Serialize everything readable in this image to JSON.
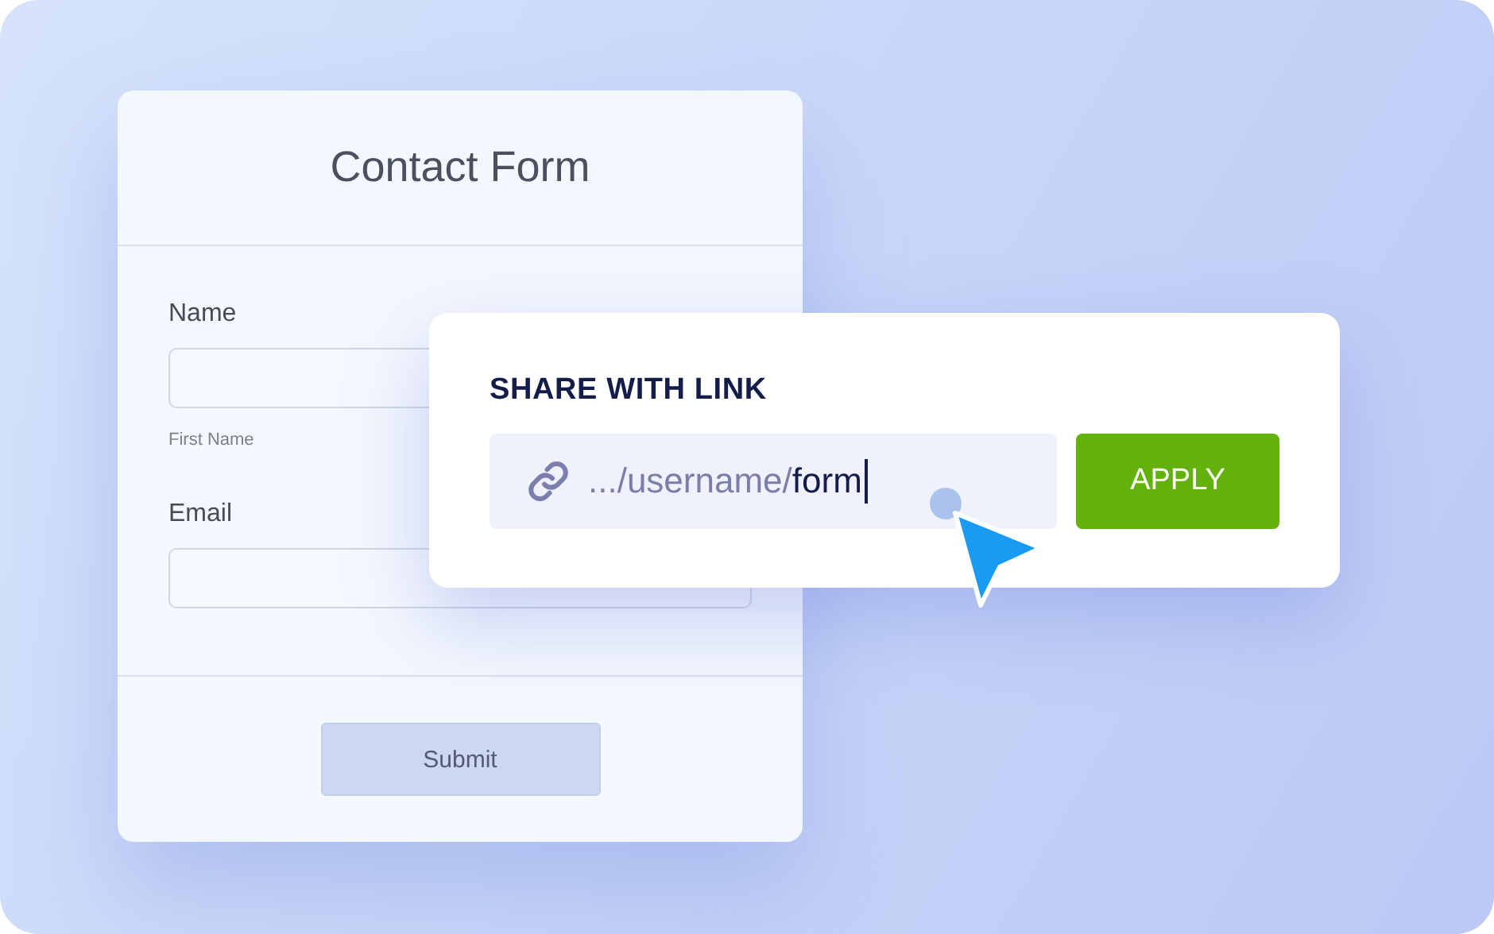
{
  "form": {
    "title": "Contact Form",
    "fields": [
      {
        "label": "Name",
        "sublabel": "First Name"
      },
      {
        "label": "Email"
      }
    ],
    "submit": "Submit"
  },
  "share": {
    "title": "SHARE WITH LINK",
    "link_prefix": ".../username/",
    "link_value": "form",
    "button": "APPLY"
  }
}
